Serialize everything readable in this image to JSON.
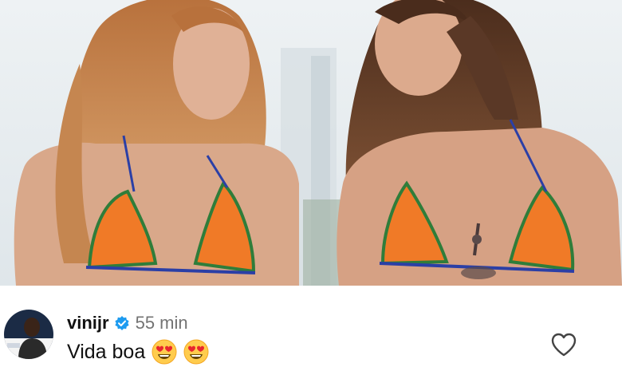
{
  "post": {
    "image": {
      "subject": "photo-of-two-people",
      "colors": {
        "sky": "#e9eef1",
        "hair": "#c0824e",
        "hair_dark": "#6b3f28",
        "skin": "#d9a88a",
        "top": "#f07a27",
        "trim_green": "#2f7d3a",
        "trim_blue": "#2b3fa6"
      }
    }
  },
  "comment": {
    "username": "vinijr",
    "verified_icon": "verified-badge-icon",
    "verified_color": "#1d9bf0",
    "timestamp": "55 min",
    "text": "Vida boa",
    "emojis": [
      "smiling-face-with-heart-eyes-icon",
      "smiling-face-with-heart-eyes-icon"
    ],
    "like_icon": "heart-outline-icon",
    "avatar_icon": "profile-avatar"
  }
}
